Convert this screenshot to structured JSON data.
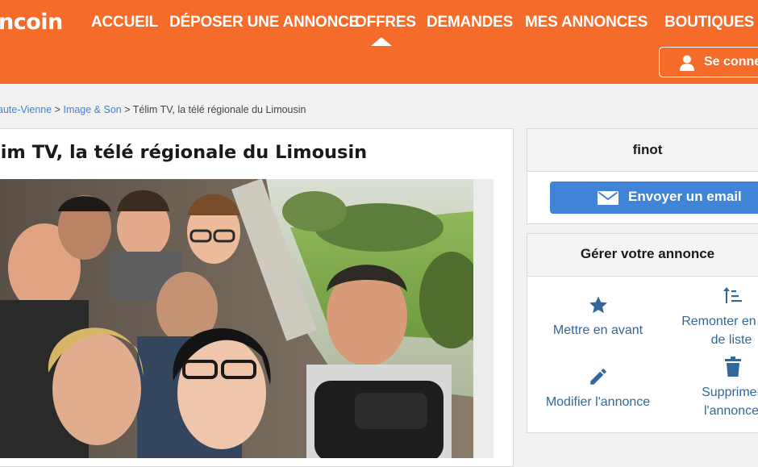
{
  "header": {
    "logo_text": "ncoin",
    "nav": [
      {
        "label": "ACCUEIL"
      },
      {
        "label": "DÉPOSER UNE ANNONCE"
      },
      {
        "label": "OFFRES",
        "active": true
      },
      {
        "label": "DEMANDES"
      },
      {
        "label": "MES ANNONCES"
      },
      {
        "label": "BOUTIQUES"
      }
    ],
    "login_label": "Se connecter"
  },
  "breadcrumb": {
    "items": [
      "aute-Vienne",
      "Image & Son"
    ],
    "separator": ">",
    "current": "Télim TV, la télé régionale du Limousin"
  },
  "ad": {
    "title": "lim TV, la télé régionale du Limousin",
    "photo_alt": "Selfie de l'équipe Télim TV devant une fenêtre avec paysage vert"
  },
  "seller": {
    "name": "finot",
    "email_label": "Envoyer un email"
  },
  "manage": {
    "title": "Gérer votre annonce",
    "actions": [
      {
        "icon": "star-icon",
        "line1": "Mettre en avant",
        "line2": ""
      },
      {
        "icon": "sort-up-icon",
        "line1": "Remonter en tête",
        "line2": "de liste"
      },
      {
        "icon": "pencil-icon",
        "line1": "Modifier l'annonce",
        "line2": ""
      },
      {
        "icon": "trash-icon",
        "line1": "Supprimer",
        "line2": "l'annonce"
      }
    ]
  },
  "colors": {
    "brand_orange": "#f56b2a",
    "link_blue": "#4183d7",
    "action_blue": "#336699"
  }
}
